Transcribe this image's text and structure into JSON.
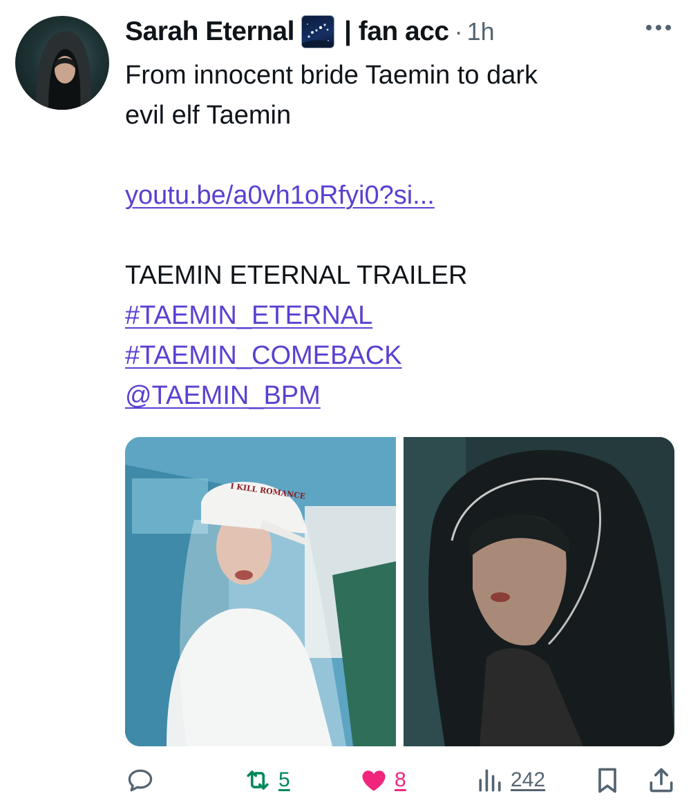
{
  "author": {
    "display_name": "Sarah Eternal",
    "name_suffix": "| fan acc",
    "emoji_icon": "night-sky-emoji",
    "time_separator": "·",
    "time": "1h",
    "more_icon": "more-dots-icon"
  },
  "tweet": {
    "lines": [
      "From innocent bride Taemin to dark",
      "evil elf Taemin"
    ],
    "link": "youtu.be/a0vh1oRfyi0?si...",
    "trailer_title": "TAEMIN ETERNAL TRAILER",
    "hashtags": [
      "#TAEMIN_ETERNAL",
      "#TAEMIN_COMEBACK"
    ],
    "mention": "@TAEMIN_BPM",
    "cap_text": "I KILL ROMANCE"
  },
  "actions": {
    "reply_icon": "reply-icon",
    "retweet_count": "5",
    "like_count": "8",
    "views_count": "242",
    "bookmark_icon": "bookmark-icon",
    "share_icon": "share-icon"
  },
  "colors": {
    "link": "#5b3fd1",
    "retweet": "#00875a",
    "like": "#f0267d",
    "muted": "#536471",
    "text": "#0f1419"
  }
}
